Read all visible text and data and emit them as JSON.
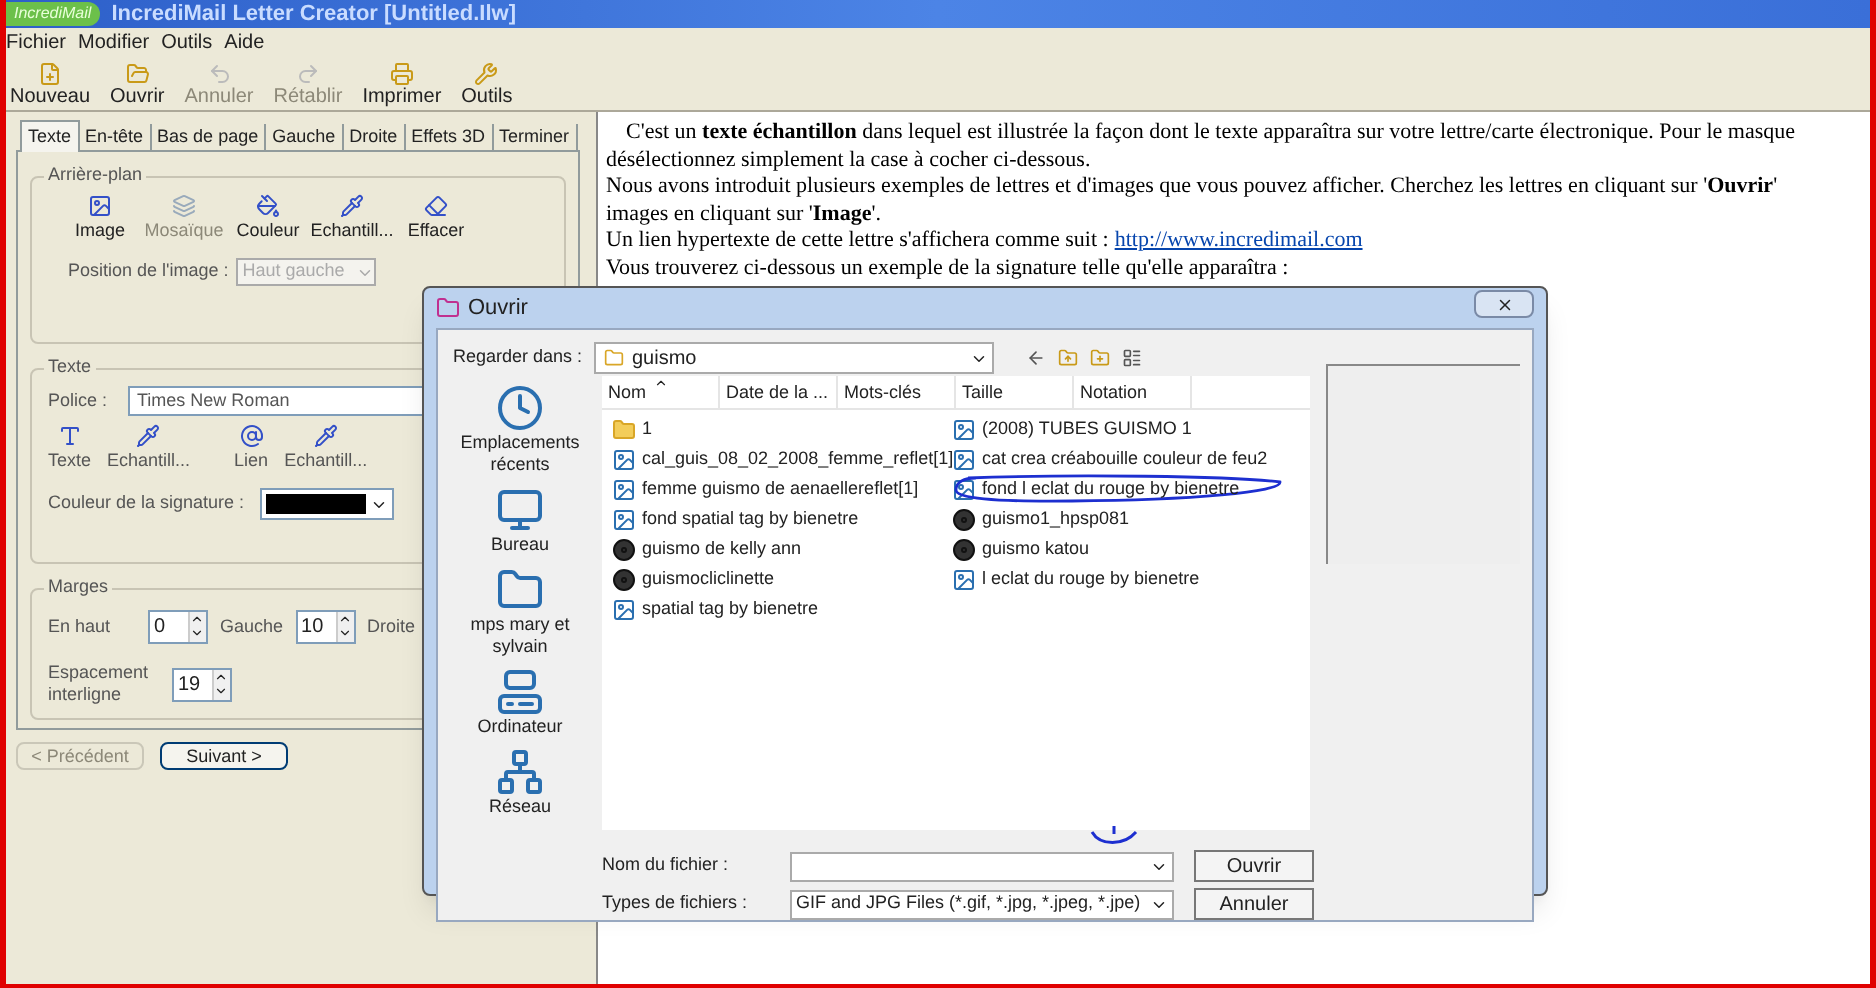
{
  "app": {
    "logo": "IncrediMail",
    "title": "IncrediMail Letter Creator [Untitled.Ilw]"
  },
  "menu": [
    "Fichier",
    "Modifier",
    "Outils",
    "Aide"
  ],
  "toolbar": [
    {
      "label": "Nouveau",
      "kind": "new",
      "disabled": false
    },
    {
      "label": "Ouvrir",
      "kind": "open",
      "disabled": false
    },
    {
      "label": "Annuler",
      "kind": "undo",
      "disabled": true
    },
    {
      "label": "Rétablir",
      "kind": "redo",
      "disabled": true
    },
    {
      "label": "Imprimer",
      "kind": "print",
      "disabled": false
    },
    {
      "label": "Outils",
      "kind": "tools",
      "disabled": false
    }
  ],
  "tabs": [
    {
      "label": "Texte",
      "selected": true
    },
    {
      "label": "En-tête",
      "selected": false
    },
    {
      "label": "Bas de page",
      "selected": false
    },
    {
      "label": "Gauche",
      "selected": false
    },
    {
      "label": "Droite",
      "selected": false
    },
    {
      "label": "Effets 3D",
      "selected": false
    },
    {
      "label": "Terminer",
      "selected": false
    }
  ],
  "background_group": {
    "title": "Arrière-plan",
    "tools": [
      {
        "label": "Image",
        "kind": "image",
        "disabled": false
      },
      {
        "label": "Mosaïque",
        "kind": "tile",
        "disabled": true
      },
      {
        "label": "Couleur",
        "kind": "color",
        "disabled": false
      },
      {
        "label": "Echantill...",
        "kind": "sample",
        "disabled": false
      },
      {
        "label": "Effacer",
        "kind": "erase",
        "disabled": false
      }
    ],
    "position_label": "Position de l'image :",
    "position_value": "Haut gauche",
    "position_disabled": true
  },
  "text_group": {
    "title": "Texte",
    "font_label": "Police :",
    "font_value": "Times New Roman",
    "tools": [
      {
        "label": "Texte",
        "kind": "text"
      },
      {
        "label": "Echantill...",
        "kind": "sample"
      },
      {
        "label": "Lien",
        "kind": "link"
      },
      {
        "label": "Echantill...",
        "kind": "sample"
      }
    ],
    "signature": {
      "label": "Couleur de la signature :",
      "color": "#000000"
    }
  },
  "margins_group": {
    "title": "Marges",
    "fields": [
      {
        "label": "En haut",
        "value": "0"
      },
      {
        "label": "Gauche",
        "value": "10"
      }
    ],
    "cut_label": "Droite",
    "spacing_label": "Espacement interligne",
    "spacing_value": "19"
  },
  "nav_buttons": [
    {
      "label": "< Précédent",
      "disabled": true
    },
    {
      "label": "Suivant >",
      "disabled": false
    }
  ],
  "document": {
    "lines": [
      {
        "text": "C'est un **texte échantillon** dans lequel est illustrée la façon dont le texte apparaîtra sur votre lettre/carte électronique. Pour le masque"
      },
      {
        "text": "désélectionnez simplement la case à cocher ci-dessous."
      },
      {
        "text": "Nous avons introduit plusieurs exemples de lettres et d'images que vous pouvez afficher. Cherchez les lettres en cliquant sur '**Ouvrir**'"
      },
      {
        "text": "images en cliquant sur '**Image**'."
      },
      {
        "text": "Un lien hypertexte de cette lettre s'affichera comme suit :",
        "link": "http://www.incredimail.com"
      },
      {
        "text": "Vous trouverez ci-dessous un exemple de la signature telle qu'elle apparaîtra :"
      }
    ]
  },
  "dialog": {
    "title": "Ouvrir",
    "look_in_label": "Regarder dans :",
    "look_in_value": "guismo",
    "places": [
      {
        "label": "Emplacements récents",
        "kind": "recent"
      },
      {
        "label": "Bureau",
        "kind": "desktop"
      },
      {
        "label": "mps mary et sylvain",
        "kind": "folder"
      },
      {
        "label": "Ordinateur",
        "kind": "computer"
      },
      {
        "label": "Réseau",
        "kind": "network"
      }
    ],
    "columns": [
      "Nom",
      "Date de la ...",
      "Mots-clés",
      "Taille",
      "Notation"
    ],
    "files": [
      {
        "name": "1",
        "kind": "folder"
      },
      {
        "name": "cal_guis_08_02_2008_femme_reflet[1]",
        "kind": "image"
      },
      {
        "name": "femme guismo de aenaellereflet[1]",
        "kind": "image"
      },
      {
        "name": "fond spatial tag by bienetre",
        "kind": "image"
      },
      {
        "name": "guismo de kelly ann",
        "kind": "disc"
      },
      {
        "name": "guismocliclinette",
        "kind": "disc"
      },
      {
        "name": "spatial tag by bienetre",
        "kind": "image"
      },
      {
        "name": "(2008) TUBES GUISMO 1",
        "kind": "image"
      },
      {
        "name": "cat crea créabouille couleur de feu2",
        "kind": "image"
      },
      {
        "name": "fond l eclat du rouge by bienetre",
        "kind": "image",
        "circled": true
      },
      {
        "name": "guismo1_hpsp081",
        "kind": "disc"
      },
      {
        "name": "guismo katou",
        "kind": "disc"
      },
      {
        "name": "l eclat du rouge by bienetre",
        "kind": "image"
      }
    ],
    "filename_label": "Nom du fichier :",
    "filetype_label": "Types de fichiers :",
    "filetype_value": "GIF and JPG Files (*.gif, *.jpg, *.jpeg, *.jpe)",
    "buttons": [
      "Ouvrir",
      "Annuler"
    ]
  }
}
